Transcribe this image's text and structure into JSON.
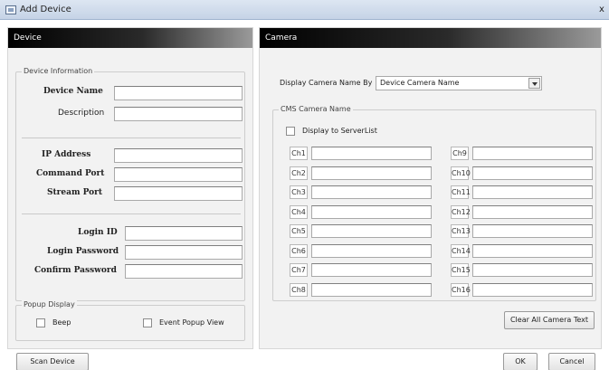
{
  "window": {
    "title": "Add Device",
    "close": "x"
  },
  "left": {
    "header": "Device",
    "device_info": {
      "title": "Device Information",
      "device_name": "Device Name",
      "description": "Description",
      "ip_address": "IP Address",
      "command_port": "Command Port",
      "stream_port": "Stream Port",
      "login_id": "Login ID",
      "login_password": "Login Password",
      "confirm_password": "Confirm Password"
    },
    "popup": {
      "title": "Popup Display",
      "beep": "Beep",
      "event_popup": "Event Popup View"
    }
  },
  "right": {
    "header": "Camera",
    "display_by_label": "Display Camera Name By",
    "display_by_value": "Device Camera Name",
    "cms": {
      "title": "CMS Camera Name",
      "display_serverlist": "Display to ServerList",
      "channels_left": [
        "Ch1",
        "Ch2",
        "Ch3",
        "Ch4",
        "Ch5",
        "Ch6",
        "Ch7",
        "Ch8"
      ],
      "channels_right": [
        "Ch9",
        "Ch10",
        "Ch11",
        "Ch12",
        "Ch13",
        "Ch14",
        "Ch15",
        "Ch16"
      ]
    },
    "clear_btn": "Clear All Camera Text"
  },
  "footer": {
    "scan": "Scan Device",
    "ok": "OK",
    "cancel": "Cancel"
  }
}
